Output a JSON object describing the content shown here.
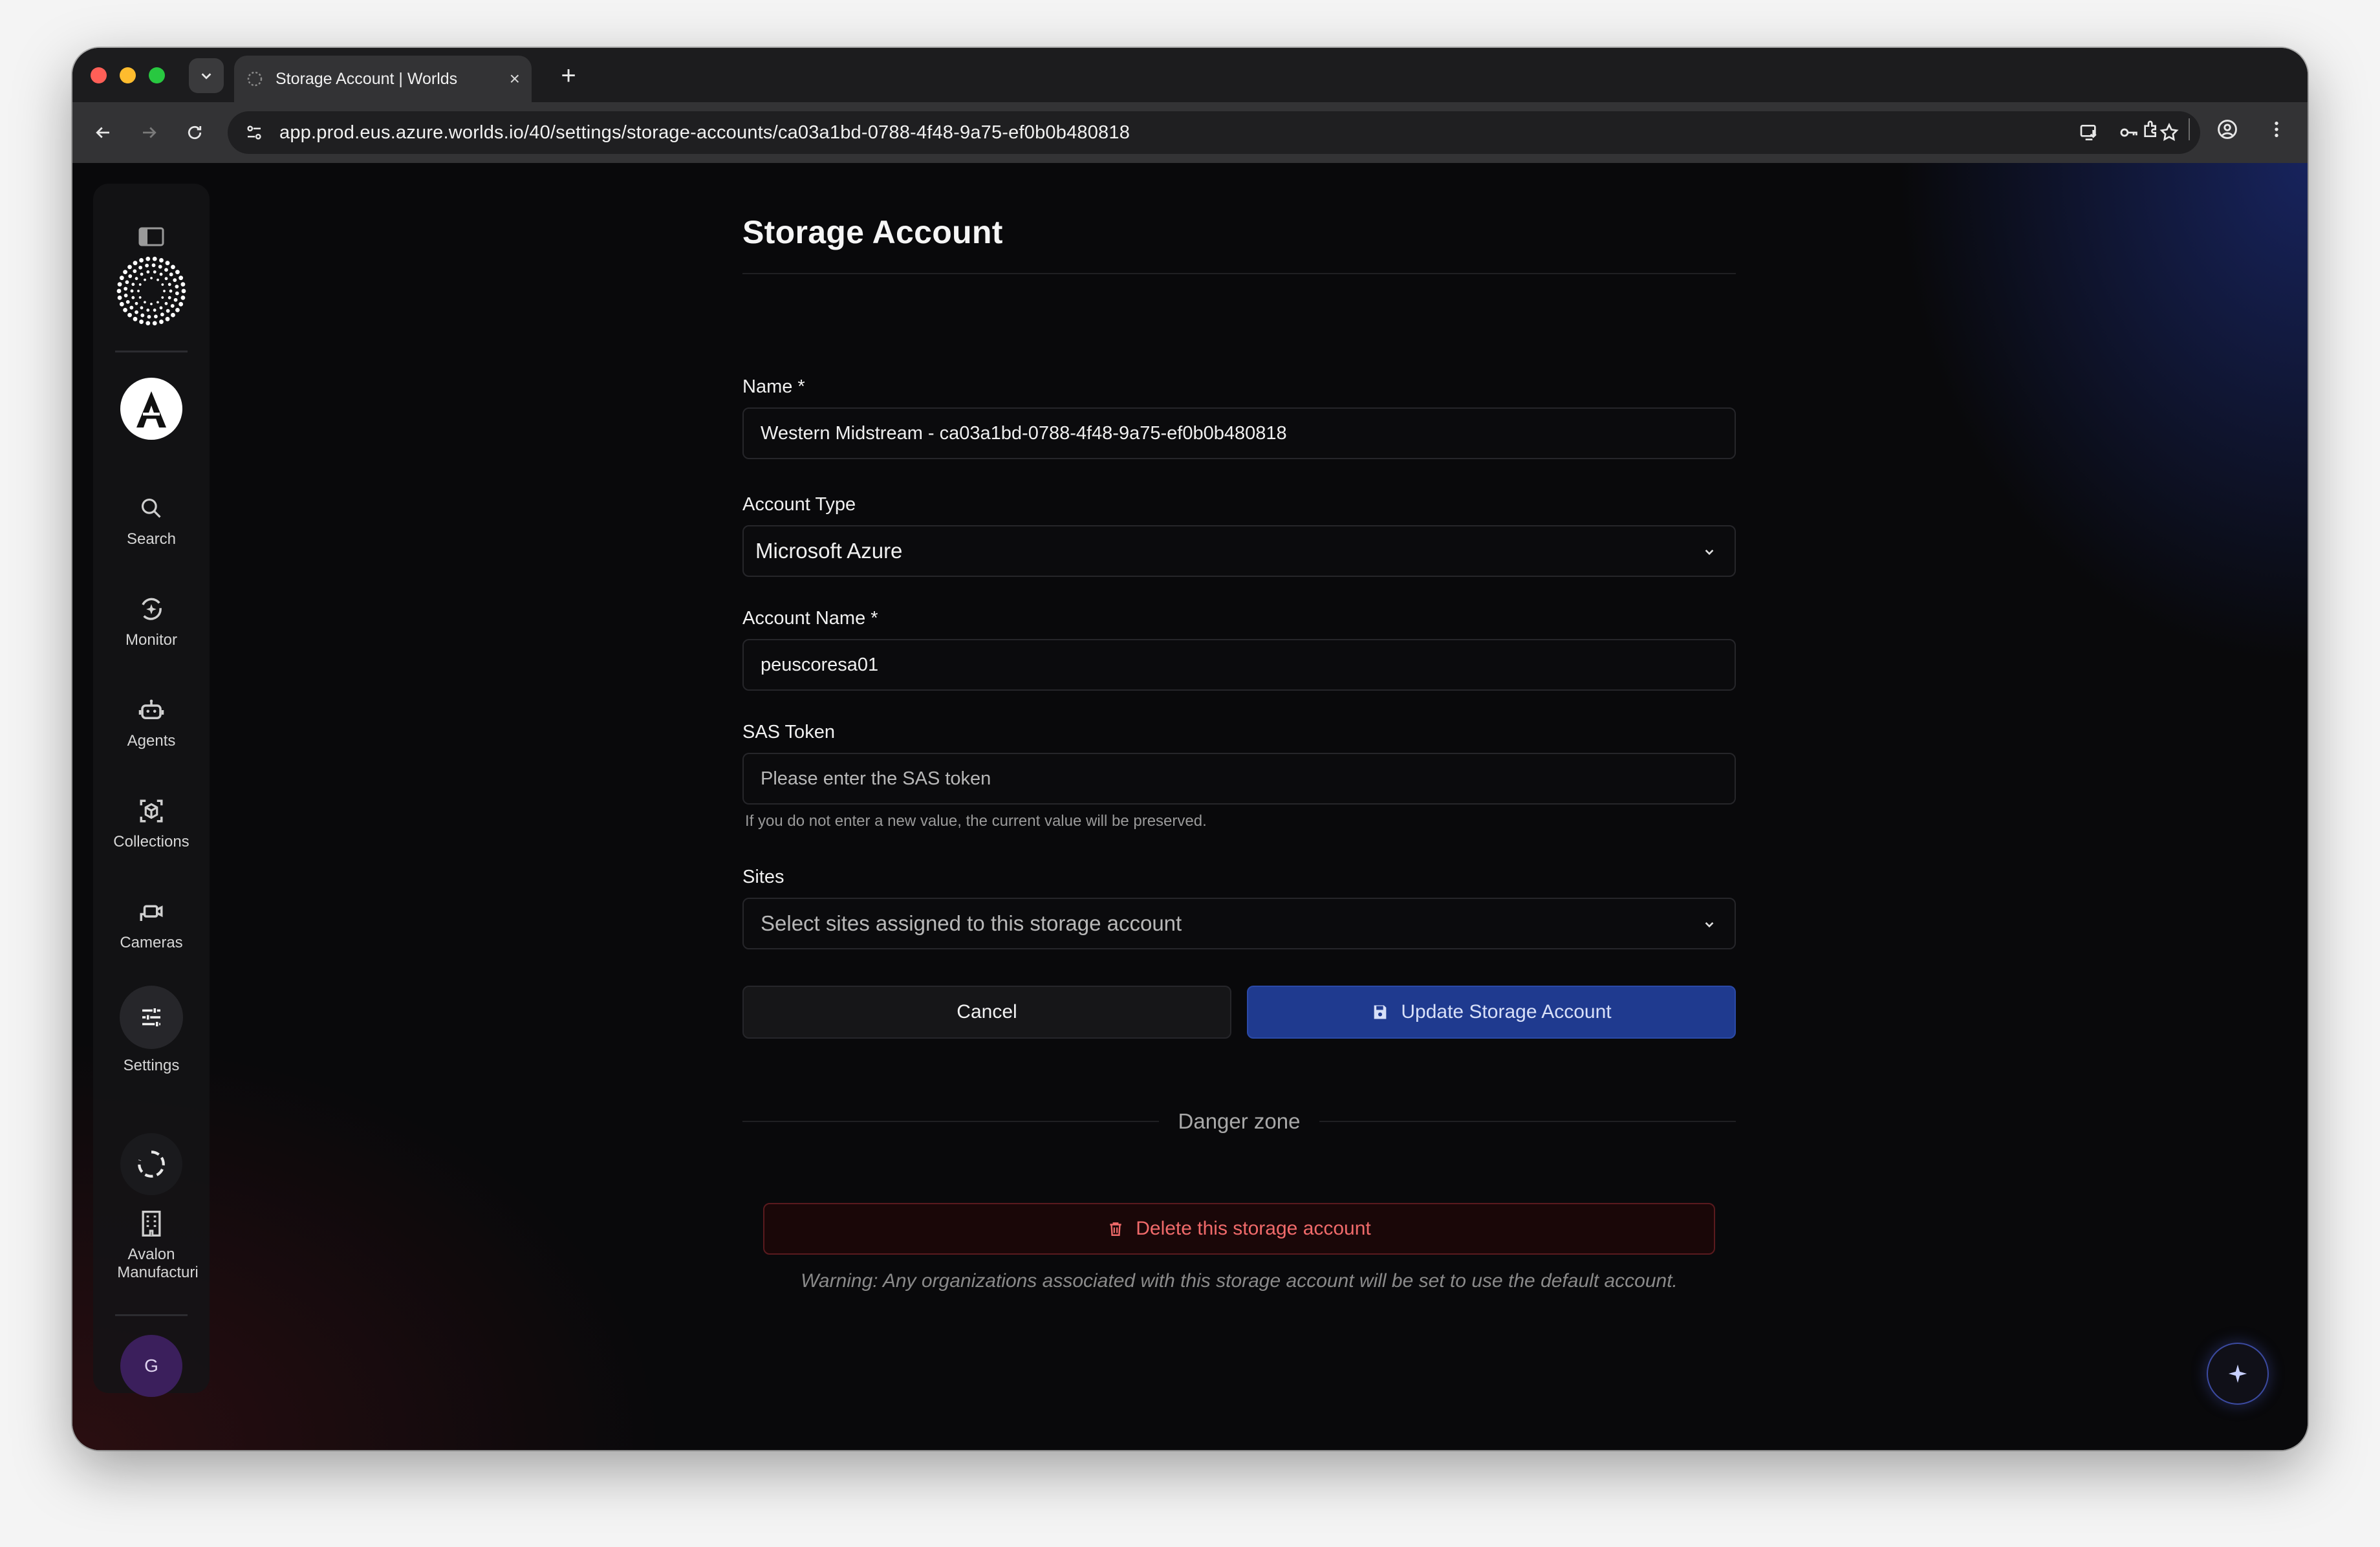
{
  "browser": {
    "tab_title": "Storage Account | Worlds",
    "new_tab_label": "+",
    "close_tab_label": "×",
    "url": "app.prod.eus.azure.worlds.io/40/settings/storage-accounts/ca03a1bd-0788-4f48-9a75-ef0b0b480818"
  },
  "sidebar": {
    "org_logo_letter": "A",
    "items": [
      {
        "label": "Search",
        "icon": "search-icon"
      },
      {
        "label": "Monitor",
        "icon": "monitor-icon"
      },
      {
        "label": "Agents",
        "icon": "robot-icon"
      },
      {
        "label": "Collections",
        "icon": "cube-icon"
      },
      {
        "label": "Cameras",
        "icon": "camera-icon"
      },
      {
        "label": "Settings",
        "icon": "sliders-icon"
      }
    ],
    "site_label_line1": "Avalon",
    "site_label_line2": "Manufacturi",
    "avatar_initial": "G"
  },
  "form": {
    "page_title": "Storage Account",
    "name_label": "Name *",
    "name_value": "Western Midstream - ca03a1bd-0788-4f48-9a75-ef0b0b480818",
    "account_type_label": "Account Type",
    "account_type_value": "Microsoft Azure",
    "account_name_label": "Account Name *",
    "account_name_value": "peuscoresa01",
    "sas_label": "SAS Token",
    "sas_placeholder": "Please enter the SAS token",
    "sas_hint": "If you do not enter a new value, the current value will be preserved.",
    "sites_label": "Sites",
    "sites_placeholder": "Select sites assigned to this storage account",
    "cancel_label": "Cancel",
    "update_label": "Update Storage Account",
    "danger_zone_label": "Danger zone",
    "delete_label": "Delete this storage account",
    "warning_text": "Warning: Any organizations associated with this storage account will be set to use the default account."
  },
  "colors": {
    "accent_blue": "#1f3a8f",
    "danger_red": "#f06a6a",
    "background": "#09090b"
  }
}
